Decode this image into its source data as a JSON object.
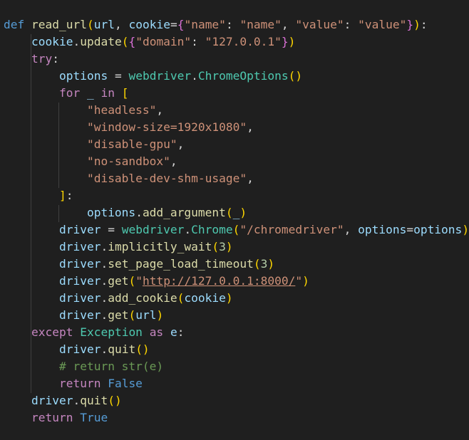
{
  "editor": {
    "language": "python",
    "theme_colors": {
      "background": "#1f1f1f",
      "keyword": "#569cd6",
      "control": "#c586c0",
      "function": "#dcdcaa",
      "variable": "#9cdcfe",
      "class": "#4ec9b0",
      "string": "#ce9178",
      "number": "#b5cea8",
      "comment": "#6a9955",
      "bracket_1": "#ffd700",
      "bracket_2": "#da70d6",
      "bracket_3": "#179fff"
    },
    "lines": [
      [
        [
          "kw",
          "def"
        ],
        [
          "pl",
          " "
        ],
        [
          "fn",
          "read_url"
        ],
        [
          "b1",
          "("
        ],
        [
          "var",
          "url"
        ],
        [
          "pl",
          ", "
        ],
        [
          "var",
          "cookie"
        ],
        [
          "pl",
          "="
        ],
        [
          "b2",
          "{"
        ],
        [
          "str",
          "\"name\""
        ],
        [
          "pl",
          ": "
        ],
        [
          "str",
          "\"name\""
        ],
        [
          "pl",
          ", "
        ],
        [
          "str",
          "\"value\""
        ],
        [
          "pl",
          ": "
        ],
        [
          "str",
          "\"value\""
        ],
        [
          "b2",
          "}"
        ],
        [
          "b1",
          ")"
        ],
        [
          "pl",
          ":"
        ]
      ],
      [
        [
          "pl",
          "    "
        ],
        [
          "var",
          "cookie"
        ],
        [
          "pl",
          "."
        ],
        [
          "fn",
          "update"
        ],
        [
          "b1",
          "("
        ],
        [
          "b2",
          "{"
        ],
        [
          "str",
          "\"domain\""
        ],
        [
          "pl",
          ": "
        ],
        [
          "str",
          "\"127.0.0.1\""
        ],
        [
          "b2",
          "}"
        ],
        [
          "b1",
          ")"
        ]
      ],
      [
        [
          "pl",
          "    "
        ],
        [
          "ctl",
          "try"
        ],
        [
          "pl",
          ":"
        ]
      ],
      [
        [
          "pl",
          "        "
        ],
        [
          "var",
          "options"
        ],
        [
          "pl",
          " = "
        ],
        [
          "cls",
          "webdriver"
        ],
        [
          "pl",
          "."
        ],
        [
          "cls",
          "ChromeOptions"
        ],
        [
          "b1",
          "()"
        ]
      ],
      [
        [
          "pl",
          "        "
        ],
        [
          "ctl",
          "for"
        ],
        [
          "pl",
          " "
        ],
        [
          "var",
          "_"
        ],
        [
          "pl",
          " "
        ],
        [
          "ctl",
          "in"
        ],
        [
          "pl",
          " "
        ],
        [
          "b1",
          "["
        ]
      ],
      [
        [
          "pl",
          "            "
        ],
        [
          "str",
          "\"headless\""
        ],
        [
          "pl",
          ","
        ]
      ],
      [
        [
          "pl",
          "            "
        ],
        [
          "str",
          "\"window-size=1920x1080\""
        ],
        [
          "pl",
          ","
        ]
      ],
      [
        [
          "pl",
          "            "
        ],
        [
          "str",
          "\"disable-gpu\""
        ],
        [
          "pl",
          ","
        ]
      ],
      [
        [
          "pl",
          "            "
        ],
        [
          "str",
          "\"no-sandbox\""
        ],
        [
          "pl",
          ","
        ]
      ],
      [
        [
          "pl",
          "            "
        ],
        [
          "str",
          "\"disable-dev-shm-usage\""
        ],
        [
          "pl",
          ","
        ]
      ],
      [
        [
          "pl",
          "        "
        ],
        [
          "b1",
          "]"
        ],
        [
          "pl",
          ":"
        ]
      ],
      [
        [
          "pl",
          "            "
        ],
        [
          "var",
          "options"
        ],
        [
          "pl",
          "."
        ],
        [
          "fn",
          "add_argument"
        ],
        [
          "b1",
          "("
        ],
        [
          "var",
          "_"
        ],
        [
          "b1",
          ")"
        ]
      ],
      [
        [
          "pl",
          "        "
        ],
        [
          "var",
          "driver"
        ],
        [
          "pl",
          " = "
        ],
        [
          "cls",
          "webdriver"
        ],
        [
          "pl",
          "."
        ],
        [
          "cls",
          "Chrome"
        ],
        [
          "b1",
          "("
        ],
        [
          "str",
          "\"/chromedriver\""
        ],
        [
          "pl",
          ", "
        ],
        [
          "var",
          "options"
        ],
        [
          "pl",
          "="
        ],
        [
          "var",
          "options"
        ],
        [
          "b1",
          ")"
        ]
      ],
      [
        [
          "pl",
          "        "
        ],
        [
          "var",
          "driver"
        ],
        [
          "pl",
          "."
        ],
        [
          "fn",
          "implicitly_wait"
        ],
        [
          "b1",
          "("
        ],
        [
          "num",
          "3"
        ],
        [
          "b1",
          ")"
        ]
      ],
      [
        [
          "pl",
          "        "
        ],
        [
          "var",
          "driver"
        ],
        [
          "pl",
          "."
        ],
        [
          "fn",
          "set_page_load_timeout"
        ],
        [
          "b1",
          "("
        ],
        [
          "num",
          "3"
        ],
        [
          "b1",
          ")"
        ]
      ],
      [
        [
          "pl",
          "        "
        ],
        [
          "var",
          "driver"
        ],
        [
          "pl",
          "."
        ],
        [
          "fn",
          "get"
        ],
        [
          "b1",
          "("
        ],
        [
          "str",
          "\""
        ],
        [
          "str url",
          "http://127.0.0.1:8000/"
        ],
        [
          "str",
          "\""
        ],
        [
          "b1",
          ")"
        ]
      ],
      [
        [
          "pl",
          "        "
        ],
        [
          "var",
          "driver"
        ],
        [
          "pl",
          "."
        ],
        [
          "fn",
          "add_cookie"
        ],
        [
          "b1",
          "("
        ],
        [
          "var",
          "cookie"
        ],
        [
          "b1",
          ")"
        ]
      ],
      [
        [
          "pl",
          "        "
        ],
        [
          "var",
          "driver"
        ],
        [
          "pl",
          "."
        ],
        [
          "fn",
          "get"
        ],
        [
          "b1",
          "("
        ],
        [
          "var",
          "url"
        ],
        [
          "b1",
          ")"
        ]
      ],
      [
        [
          "pl",
          "    "
        ],
        [
          "ctl",
          "except"
        ],
        [
          "pl",
          " "
        ],
        [
          "cls",
          "Exception"
        ],
        [
          "pl",
          " "
        ],
        [
          "ctl",
          "as"
        ],
        [
          "pl",
          " "
        ],
        [
          "var",
          "e"
        ],
        [
          "pl",
          ":"
        ]
      ],
      [
        [
          "pl",
          "        "
        ],
        [
          "var",
          "driver"
        ],
        [
          "pl",
          "."
        ],
        [
          "fn",
          "quit"
        ],
        [
          "b1",
          "()"
        ]
      ],
      [
        [
          "pl",
          "        "
        ],
        [
          "cmt",
          "# return str(e)"
        ]
      ],
      [
        [
          "pl",
          "        "
        ],
        [
          "ctl",
          "return"
        ],
        [
          "pl",
          " "
        ],
        [
          "kw",
          "False"
        ]
      ],
      [
        [
          "pl",
          "    "
        ],
        [
          "var",
          "driver"
        ],
        [
          "pl",
          "."
        ],
        [
          "fn",
          "quit"
        ],
        [
          "b1",
          "()"
        ]
      ],
      [
        [
          "pl",
          "    "
        ],
        [
          "ctl",
          "return"
        ],
        [
          "pl",
          " "
        ],
        [
          "kw",
          "True"
        ]
      ]
    ]
  }
}
